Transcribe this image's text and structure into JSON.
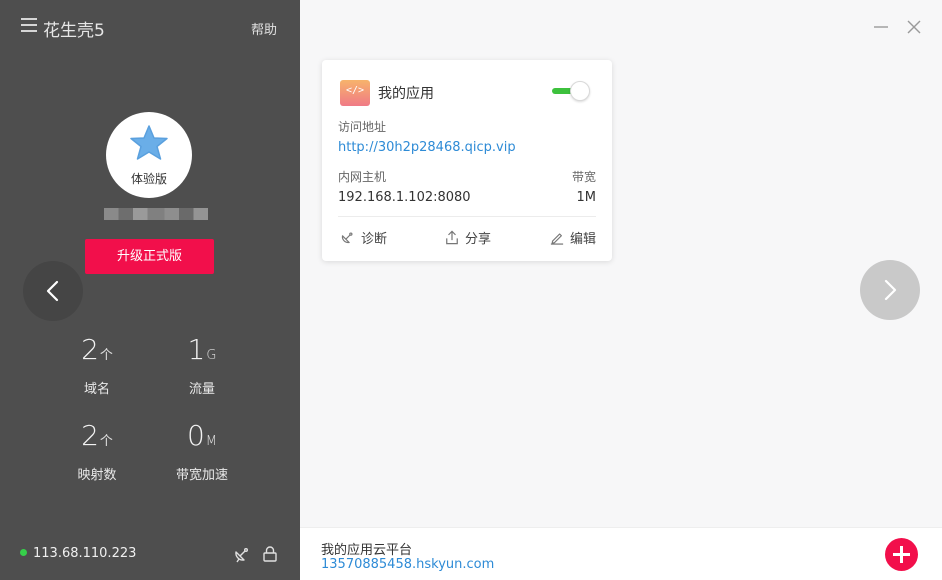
{
  "app": {
    "title": "花生壳5",
    "help_label": "帮助"
  },
  "account": {
    "edition": "体验版",
    "upgrade_label": "升级正式版"
  },
  "stats": [
    {
      "value": "2",
      "unit": "个",
      "label": "域名"
    },
    {
      "value": "1",
      "unit": "G",
      "label": "流量"
    },
    {
      "value": "2",
      "unit": "个",
      "label": "映射数"
    },
    {
      "value": "0",
      "unit": "M",
      "label": "带宽加速"
    }
  ],
  "status": {
    "ip": "113.68.110.223",
    "online_color": "#36d04a"
  },
  "card": {
    "icon_text": "</>",
    "title": "我的应用",
    "enabled": true,
    "address_label": "访问地址",
    "address_url": "http://30h2p28468.qicp.vip",
    "host_label": "内网主机",
    "host_value": "192.168.1.102:8080",
    "bandwidth_label": "带宽",
    "bandwidth_value": "1M",
    "actions": {
      "diagnose": "诊断",
      "share": "分享",
      "edit": "编辑"
    }
  },
  "footer": {
    "title": "我的应用云平台",
    "link": "13570885458.hskyun.com"
  },
  "colors": {
    "accent": "#f20f4b",
    "link": "#2e8bd6",
    "sidebar": "#4e4e4e",
    "toggle_on": "#3dc13d"
  },
  "icons": [
    "menu-icon",
    "star-icon",
    "chevron-left-icon",
    "chevron-right-icon",
    "minimize-icon",
    "close-icon",
    "diagnose-icon",
    "share-icon",
    "edit-icon",
    "satellite-icon",
    "lock-icon",
    "plus-icon"
  ]
}
